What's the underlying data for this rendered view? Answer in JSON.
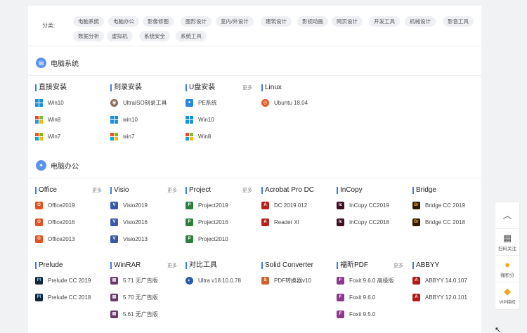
{
  "categories": {
    "label": "分类:",
    "chips": [
      "电脑系统",
      "电脑办公",
      "影像修图",
      "图形设计",
      "室内/外设计",
      "建筑设计",
      "影视动画",
      "网页设计",
      "开发工具",
      "机械设计",
      "影音工具",
      "数据分析",
      "虚拟机",
      "系统安全",
      "系统工具"
    ]
  },
  "sections": [
    {
      "title": "电脑系统",
      "icon": "monitor-icon",
      "groups": [
        {
          "title": "直接安装",
          "more": "",
          "items": [
            {
              "label": "Win10",
              "icon": "win10"
            },
            {
              "label": "Win8",
              "icon": "win8"
            },
            {
              "label": "Win7",
              "icon": "win7"
            }
          ]
        },
        {
          "title": "刻录安装",
          "more": "",
          "items": [
            {
              "label": "UltraISO刻录工具",
              "icon": "ultraiso"
            },
            {
              "label": "win10",
              "icon": "win10"
            },
            {
              "label": "win7",
              "icon": "win7"
            }
          ]
        },
        {
          "title": "U盘安装",
          "more": "更多",
          "items": [
            {
              "label": "PE系统",
              "icon": "pe"
            },
            {
              "label": "Win10",
              "icon": "win10"
            },
            {
              "label": "Win8",
              "icon": "win8"
            }
          ]
        },
        {
          "title": "Linux",
          "more": "",
          "items": [
            {
              "label": "Ubuntu 18.04",
              "icon": "ubuntu"
            }
          ]
        }
      ]
    },
    {
      "title": "电脑办公",
      "icon": "office-icon",
      "groups": [
        {
          "title": "Office",
          "more": "更多",
          "items": [
            {
              "label": "Office2019",
              "icon": "office"
            },
            {
              "label": "Office2016",
              "icon": "office"
            },
            {
              "label": "Office2013",
              "icon": "office"
            }
          ]
        },
        {
          "title": "Visio",
          "more": "更多",
          "items": [
            {
              "label": "Visio2019",
              "icon": "visio"
            },
            {
              "label": "Visio2016",
              "icon": "visio"
            },
            {
              "label": "Visio2013",
              "icon": "visio"
            }
          ]
        },
        {
          "title": "Project",
          "more": "更多",
          "items": [
            {
              "label": "Project2019",
              "icon": "project"
            },
            {
              "label": "Project2016",
              "icon": "project"
            },
            {
              "label": "Project2010",
              "icon": "project"
            }
          ]
        },
        {
          "title": "Acrobat Pro DC",
          "more": "",
          "items": [
            {
              "label": "DC 2019.012",
              "icon": "acrobat"
            },
            {
              "label": "Reader XI",
              "icon": "acrobat"
            }
          ]
        },
        {
          "title": "InCopy",
          "more": "",
          "items": [
            {
              "label": "InCopy CC2019",
              "icon": "incopy"
            },
            {
              "label": "InCopy CC2018",
              "icon": "incopy"
            }
          ]
        },
        {
          "title": "Bridge",
          "more": "",
          "items": [
            {
              "label": "Bridge CC 2019",
              "icon": "bridge"
            },
            {
              "label": "Bridge CC 2018",
              "icon": "bridge"
            }
          ]
        },
        {
          "title": "Prelude",
          "more": "",
          "items": [
            {
              "label": "Prelude CC 2019",
              "icon": "prelude"
            },
            {
              "label": "Prelude CC 2018",
              "icon": "prelude"
            }
          ]
        },
        {
          "title": "WinRAR",
          "more": "更多",
          "items": [
            {
              "label": "5.71 无广告版",
              "icon": "winrar"
            },
            {
              "label": "5.70 无广告版",
              "icon": "winrar"
            },
            {
              "label": "5.61 无广告版",
              "icon": "winrar"
            }
          ]
        },
        {
          "title": "对比工具",
          "more": "",
          "items": [
            {
              "label": "Ultra v18.10.0.78",
              "icon": "ultracompare"
            }
          ]
        },
        {
          "title": "Solid Converter",
          "more": "",
          "items": [
            {
              "label": "PDF转换器v10",
              "icon": "solid"
            }
          ]
        },
        {
          "title": "福昕PDF",
          "more": "更多",
          "items": [
            {
              "label": "Foxit 9.6.0 高级版",
              "icon": "foxit"
            },
            {
              "label": "Foxit 9.6.0",
              "icon": "foxit"
            },
            {
              "label": "Foxit 9.5.0",
              "icon": "foxit"
            }
          ]
        },
        {
          "title": "ABBYY",
          "more": "",
          "items": [
            {
              "label": "ABBYY 14.0.107",
              "icon": "abbyy"
            },
            {
              "label": "ABBYY 12.0.101",
              "icon": "abbyy"
            }
          ]
        }
      ]
    }
  ],
  "sidebar": [
    {
      "icon": "chevron-up-icon",
      "label": ""
    },
    {
      "icon": "qr-code-icon",
      "label": "扫码关注"
    },
    {
      "icon": "coins-icon",
      "label": "赚积分"
    },
    {
      "icon": "vip-diamond-icon",
      "label": "VIP特权"
    }
  ],
  "colors": {
    "accent": "#3e7be0",
    "chip_bg": "#eef0f4",
    "section_icon": "#5b93e8"
  }
}
